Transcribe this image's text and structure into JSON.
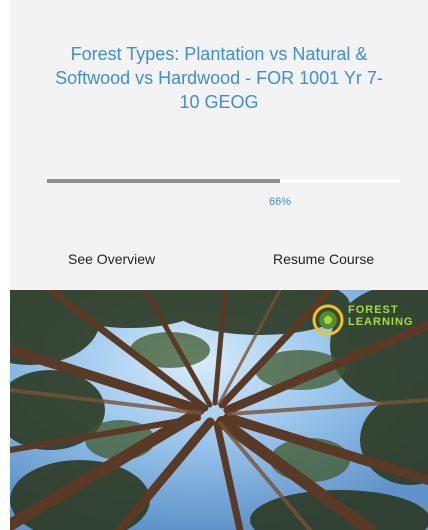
{
  "course": {
    "title": "Forest Types: Plantation vs Natural & Softwood vs Hardwood - FOR 1001 Yr 7-10 GEOG",
    "progress_fraction": 0.66,
    "progress_label": "66%"
  },
  "actions": {
    "overview_label": "See Overview",
    "resume_label": "Resume Course"
  },
  "image": {
    "logo_line1": "FOREST",
    "logo_line2": "LEARNING"
  },
  "colors": {
    "accent": "#3b8fdc",
    "card_background": "#f3f3f4",
    "progress_fill": "#8f8f8f",
    "logo_green": "#a6dc3a"
  }
}
